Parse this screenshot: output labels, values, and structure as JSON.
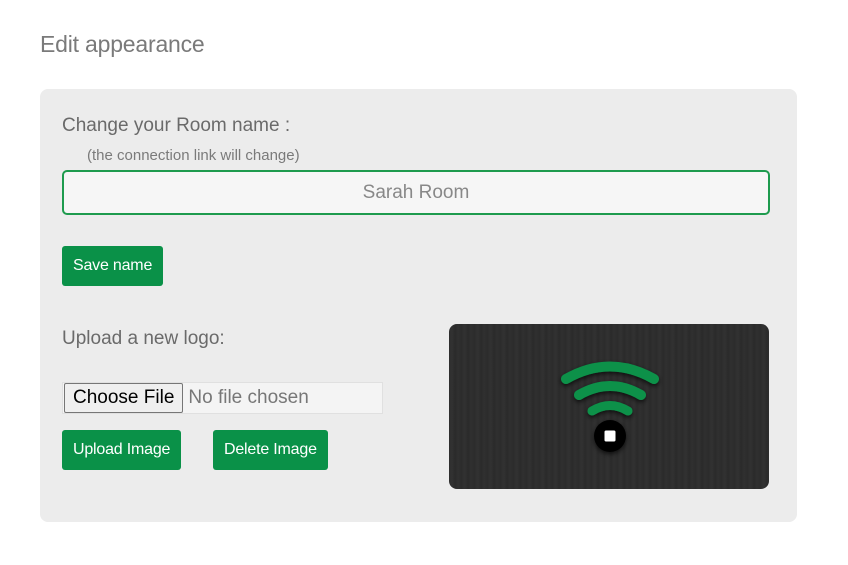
{
  "page": {
    "title": "Edit appearance"
  },
  "room": {
    "label": "Change your Room name :",
    "hint": "(the connection link will change)",
    "name_value": "Sarah Room",
    "save_label": "Save name"
  },
  "logo": {
    "label": "Upload a new logo:",
    "choose_file_label": "Choose File",
    "file_status": "No file chosen",
    "upload_label": "Upload Image",
    "delete_label": "Delete Image",
    "preview_icon": "wifi-broadcast-icon"
  },
  "colors": {
    "accent_green": "#0a9148",
    "card_background": "#ececec",
    "logo_background": "#2e2e2e"
  }
}
